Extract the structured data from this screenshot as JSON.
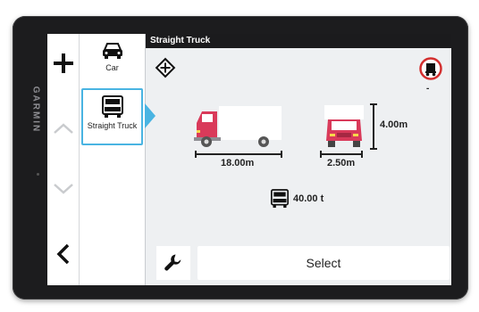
{
  "device": {
    "brand": "GARMIN"
  },
  "toolbar": {
    "add_icon": "plus-icon",
    "up_icon": "chevron-up-icon",
    "down_icon": "chevron-down-icon",
    "back_icon": "chevron-left-icon"
  },
  "vehicles": [
    {
      "label": "Car",
      "icon": "car-icon",
      "selected": false
    },
    {
      "label": "Straight Truck",
      "icon": "truck-icon",
      "selected": true
    }
  ],
  "header": {
    "title": "Straight Truck"
  },
  "profile": {
    "length": "18.00m",
    "width": "2.50m",
    "height": "4.00m",
    "weight": "40.00 t",
    "restriction_value": "-"
  },
  "footer": {
    "select_label": "Select",
    "tools_icon": "wrench-icon"
  },
  "colors": {
    "accent": "#49b4e2",
    "truck": "#d93a5a",
    "restriction": "#d32f2f"
  }
}
